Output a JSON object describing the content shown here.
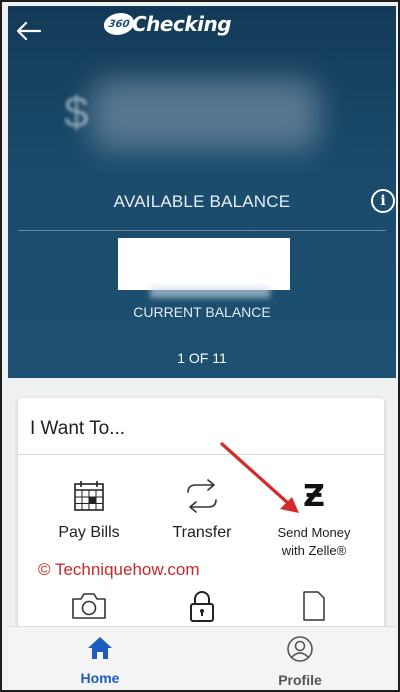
{
  "header": {
    "logo_badge": "360",
    "logo_text": "Checking",
    "balance_currency_symbol": "$",
    "available_balance_label": "AVAILABLE BALANCE",
    "current_balance_label": "CURRENT BALANCE",
    "pager": "1 OF 11"
  },
  "card": {
    "title": "I Want To...",
    "actions": [
      {
        "label": "Pay Bills",
        "icon": "calendar-icon"
      },
      {
        "label": "Transfer",
        "icon": "transfer-arrows-icon"
      },
      {
        "label": "Send Money with Zelle®",
        "icon": "zelle-icon",
        "glyph": "Ƶ"
      }
    ],
    "more_actions": [
      {
        "icon": "camera-icon"
      },
      {
        "icon": "lock-icon"
      },
      {
        "icon": "document-icon"
      }
    ]
  },
  "watermark": "© Techniquehow.com",
  "nav": {
    "items": [
      {
        "label": "Home",
        "icon": "home-icon",
        "active": true
      },
      {
        "label": "Profile",
        "icon": "profile-icon",
        "active": false
      }
    ]
  },
  "colors": {
    "header_bg": "#1d5071",
    "accent": "#1d5cbf",
    "annotation": "#d42a2a"
  }
}
